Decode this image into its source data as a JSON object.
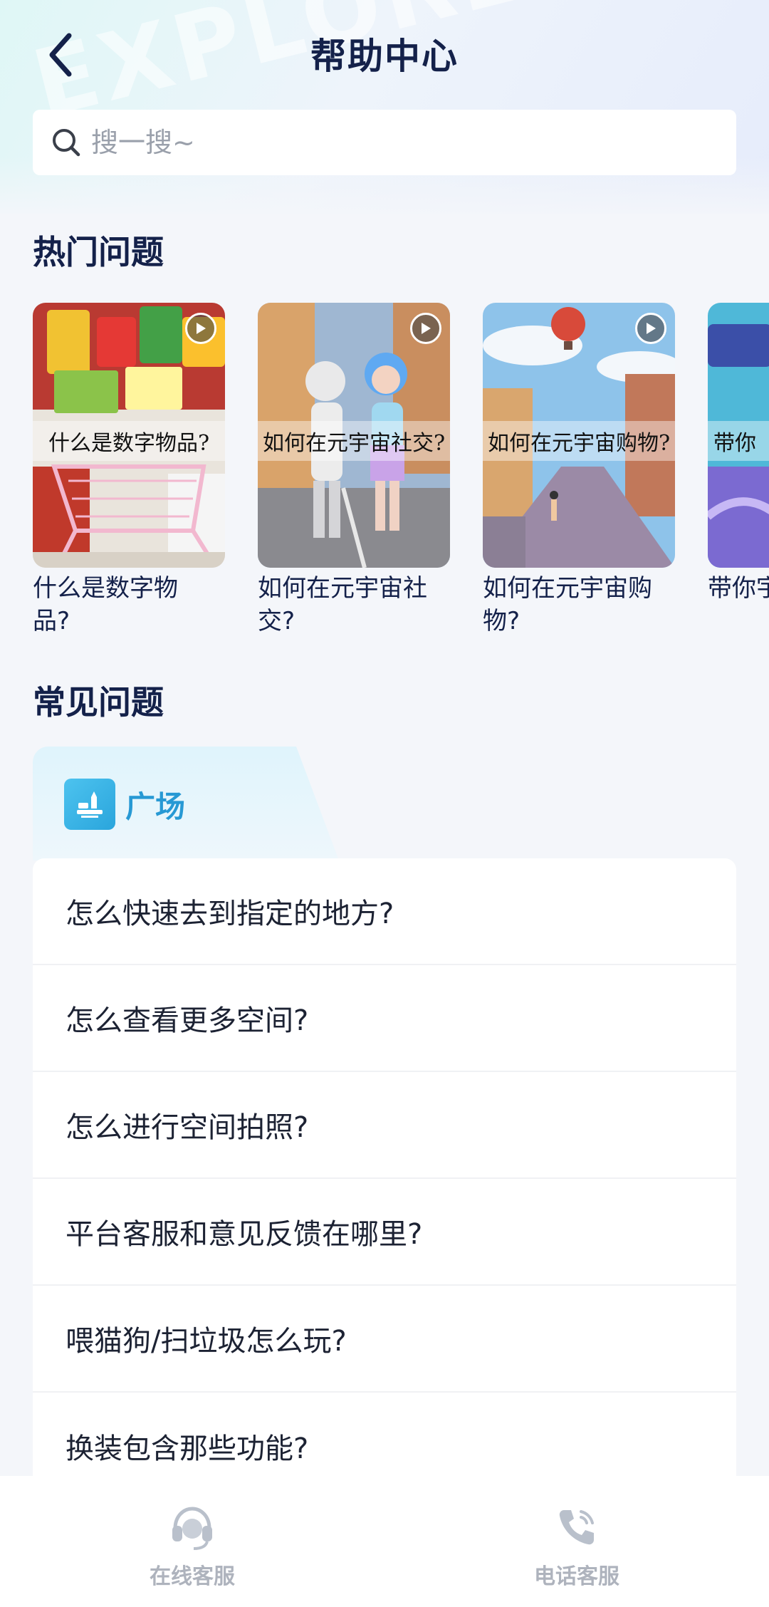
{
  "header": {
    "title": "帮助中心",
    "watermark": "EXPLORE"
  },
  "search": {
    "placeholder": "搜一搜~"
  },
  "hot": {
    "title": "热门问题",
    "items": [
      {
        "overlay": "什么是数字物品?",
        "label": "什么是数字物品?"
      },
      {
        "overlay": "如何在元宇宙社交?",
        "label": "如何在元宇宙社交?"
      },
      {
        "overlay": "如何在元宇宙购物?",
        "label": "如何在元宇宙购物?"
      },
      {
        "overlay": "带你",
        "label": "带你宇宙"
      }
    ]
  },
  "common": {
    "title": "常见问题",
    "tab": {
      "label": "广场",
      "icon": "plaza-icon"
    },
    "faqs": [
      "怎么快速去到指定的地方?",
      "怎么查看更多空间?",
      "怎么进行空间拍照?",
      "平台客服和意见反馈在哪里?",
      "喂猫狗/扫垃圾怎么玩?",
      "换装包含那些功能?"
    ]
  },
  "bottom": {
    "online": {
      "label": "在线客服",
      "icon": "headset-icon"
    },
    "phone": {
      "label": "电话客服",
      "icon": "phone-icon"
    }
  },
  "colors": {
    "title": "#14214a",
    "accent": "#2799d4",
    "muted": "#aeb3bd"
  }
}
